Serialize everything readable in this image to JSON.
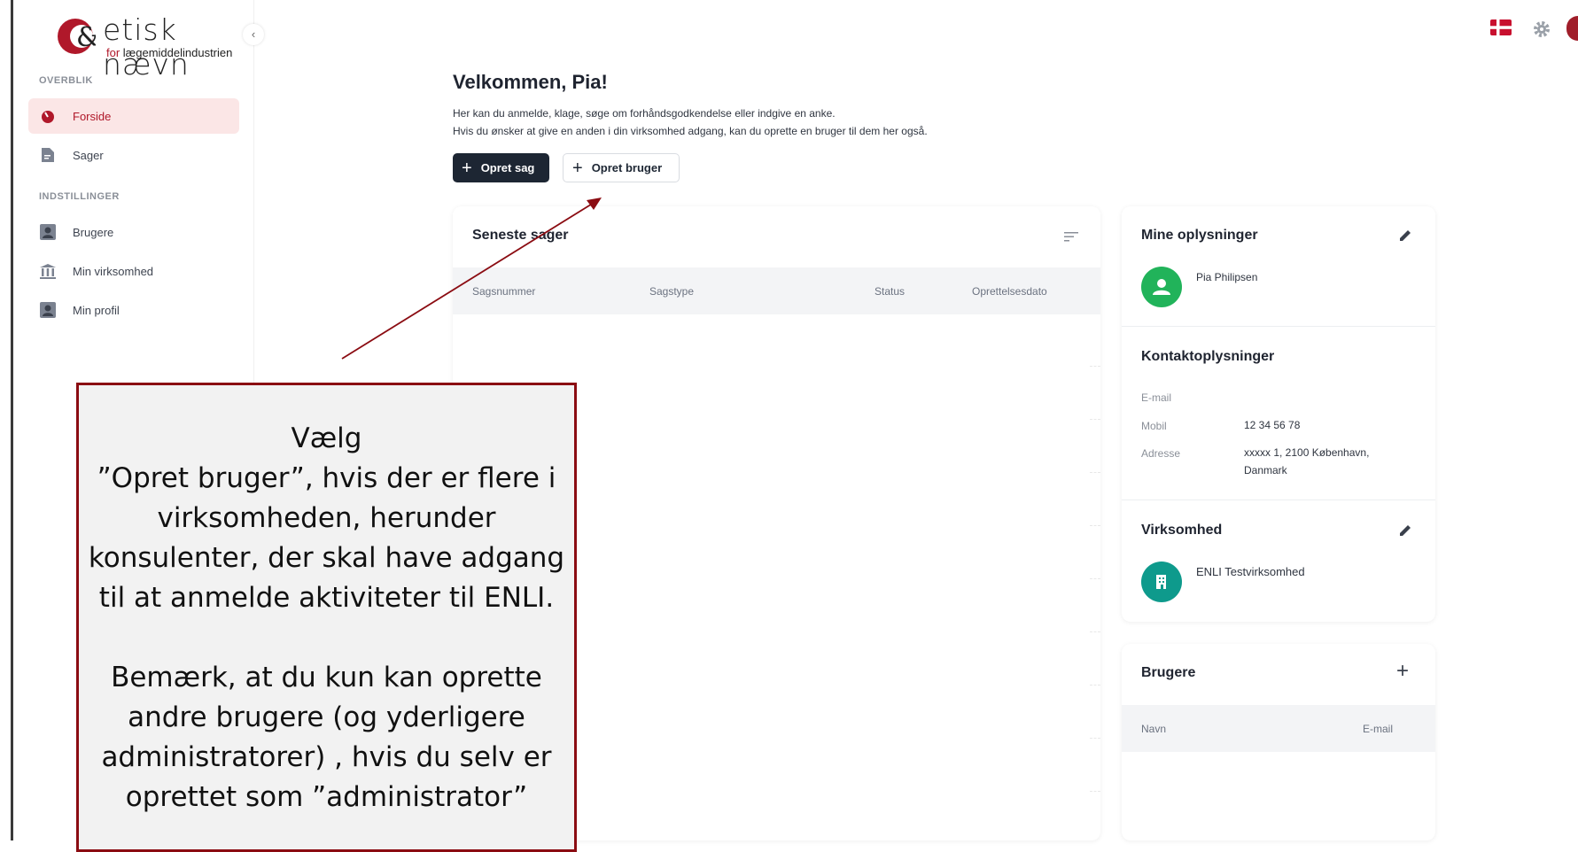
{
  "logo": {
    "title": "etisk nævn",
    "sub_prefix": "for",
    "sub_rest": " lægemiddelindustrien"
  },
  "sidebar": {
    "sections": [
      {
        "label": "OVERBLIK"
      },
      {
        "label": "INDSTILLINGER"
      }
    ],
    "items": [
      {
        "label": "Forside",
        "icon": "dashboard-icon",
        "active": true
      },
      {
        "label": "Sager",
        "icon": "document-icon"
      },
      {
        "label": "Brugere",
        "icon": "user-icon"
      },
      {
        "label": "Min virksomhed",
        "icon": "building-icon"
      },
      {
        "label": "Min profil",
        "icon": "user-icon"
      }
    ]
  },
  "header": {
    "flag": "danish-flag-icon",
    "settings": "gear-icon",
    "avatar": "avatar"
  },
  "main": {
    "title": "Velkommen, Pia!",
    "intro_lines": [
      "Her kan du anmelde, klage, søge om forhåndsgodkendelse eller indgive en anke.",
      "Hvis du ønsker at give en anden i din virksomhed adgang, kan du oprette en bruger til dem her også."
    ],
    "buttons": {
      "create_case": "Opret sag",
      "create_user": "Opret bruger"
    }
  },
  "recent_cases": {
    "title": "Seneste sager",
    "columns": [
      "Sagsnummer",
      "Sagstype",
      "Status",
      "Oprettelsesdato"
    ],
    "rows": []
  },
  "my_info": {
    "title": "Mine oplysninger",
    "name": "Pia Philipsen",
    "contact_title": "Kontaktoplysninger",
    "contact": [
      {
        "label": "E-mail",
        "value": ""
      },
      {
        "label": "Mobil",
        "value": "12 34 56 78"
      },
      {
        "label": "Adresse",
        "value": "xxxxx 1, 2100 København, Danmark"
      }
    ],
    "company_title": "Virksomhed",
    "company_name": "ENLI Testvirksomhed"
  },
  "users": {
    "title": "Brugere",
    "columns": [
      "Navn",
      "E-mail"
    ]
  },
  "callout": {
    "paragraph1": [
      "Vælg",
      "”Opret bruger”, hvis der er flere i",
      "virksomheden, herunder",
      "konsulenter, der skal have adgang",
      "til at anmelde aktiviteter til ENLI."
    ],
    "paragraph2": [
      "Bemærk, at du kun kan oprette",
      "andre brugere (og yderligere",
      "administratorer) , hvis du selv er",
      "oprettet som ”administrator”"
    ]
  },
  "colors": {
    "brand": "#b0182a",
    "dark_button": "#1d2633",
    "callout_border": "#8b0c12",
    "green": "#21b35a",
    "teal": "#0e9a8c"
  }
}
